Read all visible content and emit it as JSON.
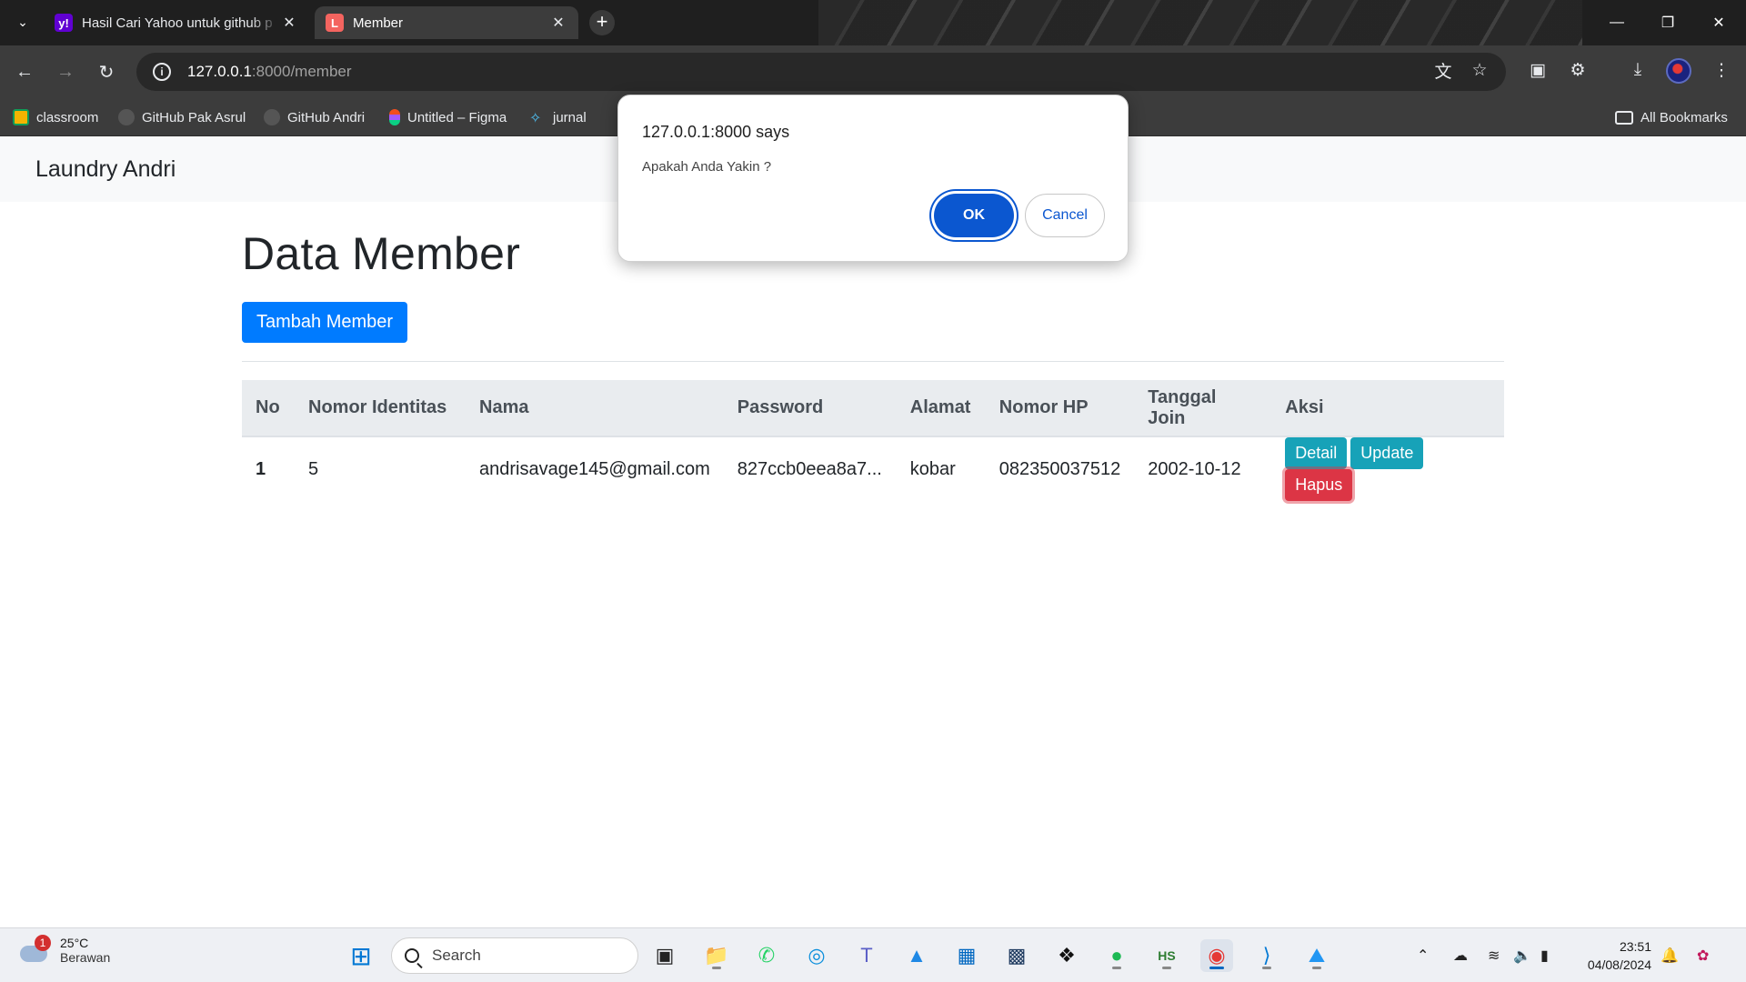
{
  "browser": {
    "tabs": [
      {
        "title": "Hasil Cari Yahoo untuk github p",
        "favicon": "yahoo-icon",
        "active": false
      },
      {
        "title": "Member",
        "favicon": "laravel-icon",
        "active": true
      }
    ],
    "url_host": "127.0.0.1",
    "url_path": ":8000/member",
    "bookmarks": [
      {
        "label": "classroom",
        "icon": "classroom-icon"
      },
      {
        "label": "GitHub Pak Asrul",
        "icon": "github-icon"
      },
      {
        "label": "GitHub Andri",
        "icon": "github-icon"
      },
      {
        "label": "Untitled – Figma",
        "icon": "figma-icon"
      },
      {
        "label": "jurnal",
        "icon": "jurnal-icon"
      }
    ],
    "all_bookmarks": "All Bookmarks"
  },
  "app": {
    "brand": "Laundry Andri",
    "page_title": "Data Member",
    "add_button": "Tambah Member"
  },
  "table": {
    "headers": [
      "No",
      "Nomor Identitas",
      "Nama",
      "Password",
      "Alamat",
      "Nomor HP",
      "Tanggal Join",
      "Aksi"
    ],
    "rows": [
      {
        "no": "1",
        "nomor_identitas": "5",
        "nama": "andrisavage145@gmail.com",
        "password": "827ccb0eea8a7...",
        "alamat": "kobar",
        "nomor_hp": "082350037512",
        "tanggal_join": "2002-10-12",
        "actions": {
          "detail": "Detail",
          "update": "Update",
          "hapus": "Hapus"
        }
      }
    ]
  },
  "dialog": {
    "title": "127.0.0.1:8000 says",
    "message": "Apakah Anda Yakin ?",
    "ok": "OK",
    "cancel": "Cancel"
  },
  "taskbar": {
    "weather_temp": "25°C",
    "weather_condition": "Berawan",
    "weather_badge": "1",
    "search_placeholder": "Search",
    "time": "23:51",
    "date": "04/08/2024"
  },
  "colors": {
    "primary": "#007bff",
    "info": "#17a2b8",
    "danger": "#dc3545",
    "dialog_ok": "#0b57d0"
  }
}
